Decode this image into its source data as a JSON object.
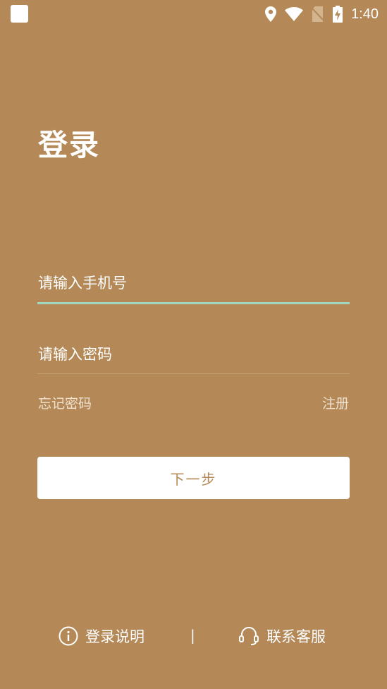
{
  "status_bar": {
    "time": "1:40",
    "icons": [
      "app-notification-icon",
      "location-icon",
      "wifi-icon",
      "no-sim-icon",
      "battery-charging-icon"
    ]
  },
  "title": "登录",
  "phone_input": {
    "placeholder": "请输入手机号",
    "value": ""
  },
  "password_input": {
    "placeholder": "请输入密码",
    "value": ""
  },
  "links": {
    "forgot_password": "忘记密码",
    "register": "注册"
  },
  "next_button": {
    "label": "下一步"
  },
  "footer": {
    "login_info": "登录说明",
    "separator": "|",
    "customer_service": "联系客服"
  },
  "colors": {
    "background": "#B48957",
    "accent_underline": "#9FD4BE",
    "button_bg": "#FFFFFF",
    "button_text": "#B48957"
  }
}
